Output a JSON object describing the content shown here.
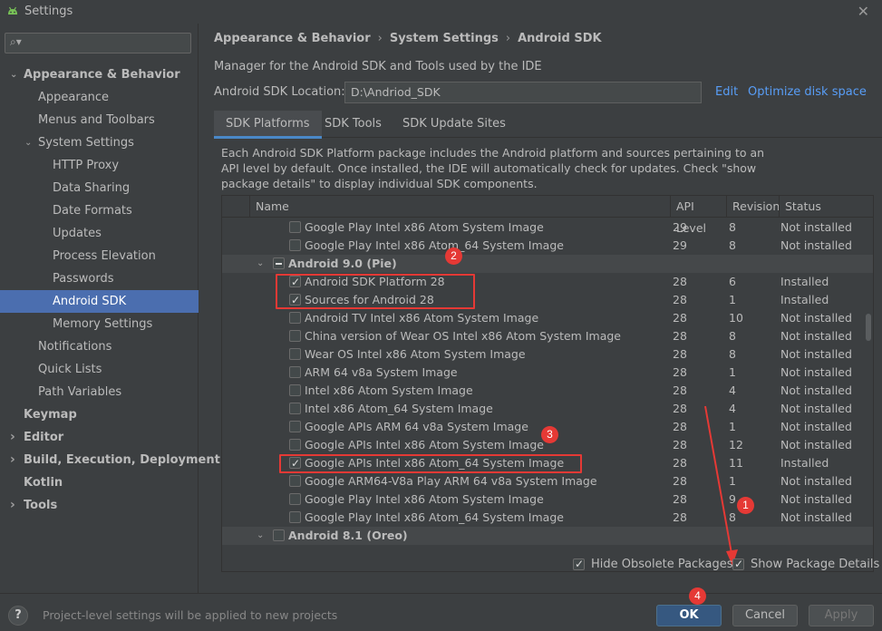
{
  "window": {
    "title": "Settings"
  },
  "sidebar": {
    "search_placeholder": "",
    "items": [
      {
        "label": "Appearance & Behavior",
        "level": 0,
        "bold": true,
        "expanded": true
      },
      {
        "label": "Appearance",
        "level": 1
      },
      {
        "label": "Menus and Toolbars",
        "level": 1
      },
      {
        "label": "System Settings",
        "level": 1,
        "expanded": true
      },
      {
        "label": "HTTP Proxy",
        "level": 2
      },
      {
        "label": "Data Sharing",
        "level": 2
      },
      {
        "label": "Date Formats",
        "level": 2
      },
      {
        "label": "Updates",
        "level": 2
      },
      {
        "label": "Process Elevation",
        "level": 2
      },
      {
        "label": "Passwords",
        "level": 2
      },
      {
        "label": "Android SDK",
        "level": 2,
        "selected": true
      },
      {
        "label": "Memory Settings",
        "level": 2
      },
      {
        "label": "Notifications",
        "level": 1
      },
      {
        "label": "Quick Lists",
        "level": 1
      },
      {
        "label": "Path Variables",
        "level": 1
      },
      {
        "label": "Keymap",
        "level": 0,
        "bold": true
      },
      {
        "label": "Editor",
        "level": 0,
        "bold": true,
        "collapsed": true
      },
      {
        "label": "Build, Execution, Deployment",
        "level": 0,
        "bold": true,
        "collapsed": true
      },
      {
        "label": "Kotlin",
        "level": 0,
        "bold": true
      },
      {
        "label": "Tools",
        "level": 0,
        "bold": true,
        "collapsed": true
      }
    ]
  },
  "breadcrumb": {
    "part1": "Appearance & Behavior",
    "part2": "System Settings",
    "part3": "Android SDK",
    "separator": "›"
  },
  "main": {
    "description": "Manager for the Android SDK and Tools used by the IDE",
    "sdk_location_label": "Android SDK Location:",
    "sdk_location_value": "D:\\Andriod_SDK",
    "edit_link": "Edit",
    "optimize_link": "Optimize disk space",
    "tabs": [
      "SDK Platforms",
      "SDK Tools",
      "SDK Update Sites"
    ],
    "info_text": "Each Android SDK Platform package includes the Android platform and sources pertaining to an API level by default. Once installed, the IDE will automatically check for updates. Check \"show package details\" to display individual SDK components."
  },
  "table": {
    "headers": {
      "name": "Name",
      "api": "API Level",
      "revision": "Revision",
      "status": "Status"
    },
    "rows": [
      {
        "name": "Google Play Intel x86 Atom System Image",
        "api": "29",
        "rev": "8",
        "status": "Not installed",
        "checked": false
      },
      {
        "name": "Google Play Intel x86 Atom_64 System Image",
        "api": "29",
        "rev": "8",
        "status": "Not installed",
        "checked": false
      },
      {
        "name": "Android 9.0 (Pie)",
        "group": true,
        "state": "partial",
        "expanded": true
      },
      {
        "name": "Android SDK Platform 28",
        "api": "28",
        "rev": "6",
        "status": "Installed",
        "checked": true
      },
      {
        "name": "Sources for Android 28",
        "api": "28",
        "rev": "1",
        "status": "Installed",
        "checked": true
      },
      {
        "name": "Android TV Intel x86 Atom System Image",
        "api": "28",
        "rev": "10",
        "status": "Not installed",
        "checked": false
      },
      {
        "name": "China version of Wear OS Intel x86 Atom System Image",
        "api": "28",
        "rev": "8",
        "status": "Not installed",
        "checked": false
      },
      {
        "name": "Wear OS Intel x86 Atom System Image",
        "api": "28",
        "rev": "8",
        "status": "Not installed",
        "checked": false
      },
      {
        "name": "ARM 64 v8a System Image",
        "api": "28",
        "rev": "1",
        "status": "Not installed",
        "checked": false
      },
      {
        "name": "Intel x86 Atom System Image",
        "api": "28",
        "rev": "4",
        "status": "Not installed",
        "checked": false
      },
      {
        "name": "Intel x86 Atom_64 System Image",
        "api": "28",
        "rev": "4",
        "status": "Not installed",
        "checked": false
      },
      {
        "name": "Google APIs ARM 64 v8a System Image",
        "api": "28",
        "rev": "1",
        "status": "Not installed",
        "checked": false
      },
      {
        "name": "Google APIs Intel x86 Atom System Image",
        "api": "28",
        "rev": "12",
        "status": "Not installed",
        "checked": false
      },
      {
        "name": "Google APIs Intel x86 Atom_64 System Image",
        "api": "28",
        "rev": "11",
        "status": "Installed",
        "checked": true
      },
      {
        "name": "Google ARM64-V8a Play ARM 64 v8a System Image",
        "api": "28",
        "rev": "1",
        "status": "Not installed",
        "checked": false
      },
      {
        "name": "Google Play Intel x86 Atom System Image",
        "api": "28",
        "rev": "9",
        "status": "Not installed",
        "checked": false
      },
      {
        "name": "Google Play Intel x86 Atom_64 System Image",
        "api": "28",
        "rev": "8",
        "status": "Not installed",
        "checked": false
      },
      {
        "name": "Android 8.1 (Oreo)",
        "group": true,
        "state": "unchecked",
        "expanded": true
      }
    ]
  },
  "options": {
    "hide_obsolete": "Hide Obsolete Packages",
    "show_details": "Show Package Details"
  },
  "annotations": [
    "1",
    "2",
    "3",
    "4"
  ],
  "footer": {
    "note": "Project-level settings will be applied to new projects",
    "ok": "OK",
    "cancel": "Cancel",
    "apply": "Apply",
    "help": "?"
  },
  "colors": {
    "background": "#3c3f41",
    "selection": "#4b6eaf",
    "link": "#589df6",
    "annotation": "#e53935",
    "primary_button": "#365880"
  }
}
